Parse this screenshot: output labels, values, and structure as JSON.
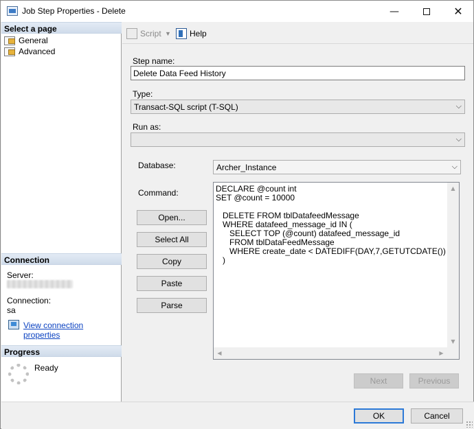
{
  "window": {
    "title": "Job Step Properties - Delete",
    "controls": {
      "minimize": "—",
      "close": "✕"
    }
  },
  "left_pane": {
    "select_page_header": "Select a page",
    "pages": [
      {
        "label": "General",
        "icon": "wrench-page-icon"
      },
      {
        "label": "Advanced",
        "icon": "wrench-page-icon"
      }
    ],
    "connection_header": "Connection",
    "server_label": "Server:",
    "connection_label": "Connection:",
    "connection_value": "sa",
    "view_connection_link": "View connection properties",
    "progress_header": "Progress",
    "progress_status": "Ready"
  },
  "toolbar": {
    "script_label": "Script",
    "script_dropdown": "▼",
    "help_label": "Help"
  },
  "form": {
    "step_name_label": "Step name:",
    "step_name_value": "Delete Data Feed History",
    "type_label": "Type:",
    "type_value": "Transact-SQL script (T-SQL)",
    "run_as_label": "Run as:",
    "run_as_value": "",
    "database_label": "Database:",
    "database_value": "Archer_Instance",
    "command_label": "Command:",
    "command_text": "DECLARE @count int\nSET @count = 10000\n\n   DELETE FROM tblDatafeedMessage\n   WHERE datafeed_message_id IN (\n      SELECT TOP (@count) datafeed_message_id\n      FROM tblDataFeedMessage\n      WHERE create_date < DATEDIFF(DAY,7,GETUTCDATE())\n   )",
    "combo_arrow": "⌵"
  },
  "command_buttons": {
    "open": "Open...",
    "select_all": "Select All",
    "copy": "Copy",
    "paste": "Paste",
    "parse": "Parse"
  },
  "nav_buttons": {
    "next": "Next",
    "previous": "Previous"
  },
  "footer": {
    "ok": "OK",
    "cancel": "Cancel"
  },
  "scroll": {
    "up": "▲",
    "down": "▼",
    "left": "◀",
    "right": "▶"
  }
}
